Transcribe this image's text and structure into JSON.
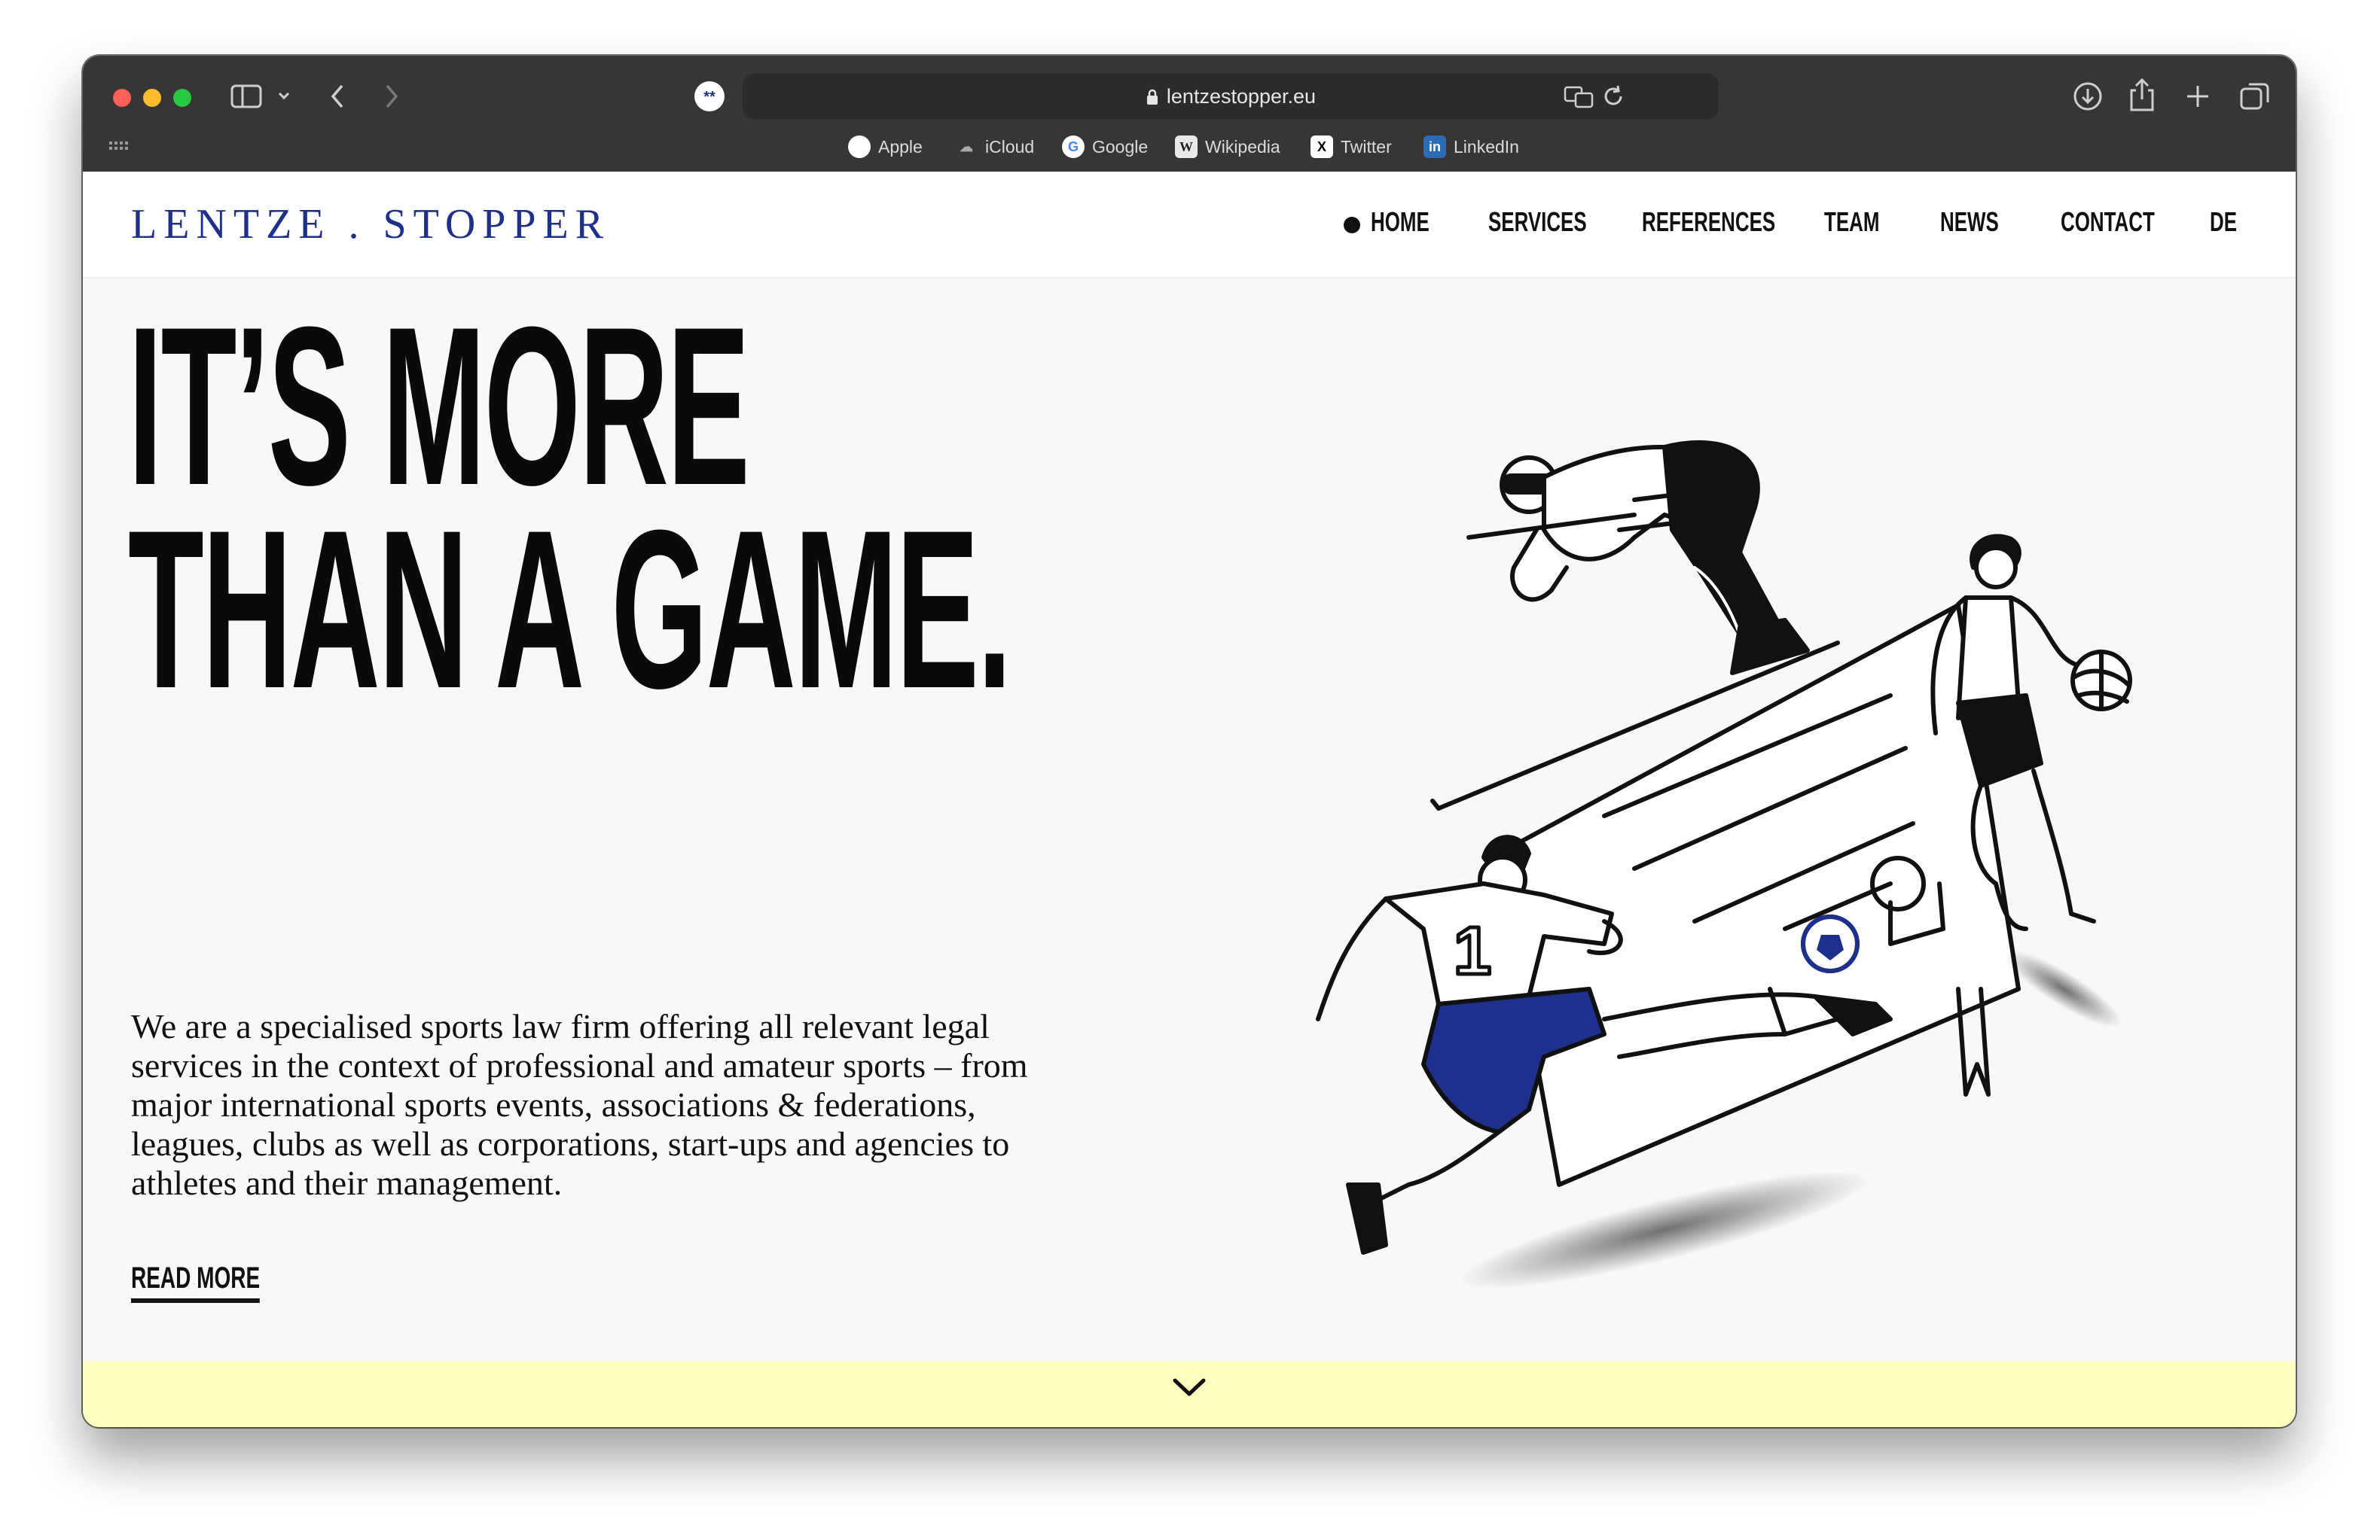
{
  "browser": {
    "url": "lentzestopper.eu",
    "bookmarks": [
      {
        "label": "Apple",
        "icon": "apple-icon"
      },
      {
        "label": "iCloud",
        "icon": "icloud-icon"
      },
      {
        "label": "Google",
        "icon": "google-icon"
      },
      {
        "label": "Wikipedia",
        "icon": "wikipedia-icon"
      },
      {
        "label": "Twitter",
        "icon": "twitter-icon"
      },
      {
        "label": "LinkedIn",
        "icon": "linkedin-icon"
      }
    ]
  },
  "site": {
    "logo": "LENTZE . STOPPER",
    "nav": [
      {
        "label": "HOME",
        "active": true
      },
      {
        "label": "SERVICES"
      },
      {
        "label": "REFERENCES"
      },
      {
        "label": "TEAM"
      },
      {
        "label": "NEWS"
      },
      {
        "label": "CONTACT"
      },
      {
        "label": "DE"
      }
    ]
  },
  "hero": {
    "title_line1": "IT’S MORE",
    "title_line2": "THAN A GAME.",
    "description": "We are a specialised sports law firm offering all relevant legal services in the context of professional and amateur sports – from major international sports events, associations & federations, leagues, clubs as well as corporations, start-ups and agencies to athletes and their management.",
    "read_more": "READ MORE"
  },
  "colors": {
    "brand_blue": "#1f2f8c",
    "band_yellow": "#ffffc0",
    "page_bg": "#f8f8f6",
    "chrome_bg": "#363636"
  }
}
